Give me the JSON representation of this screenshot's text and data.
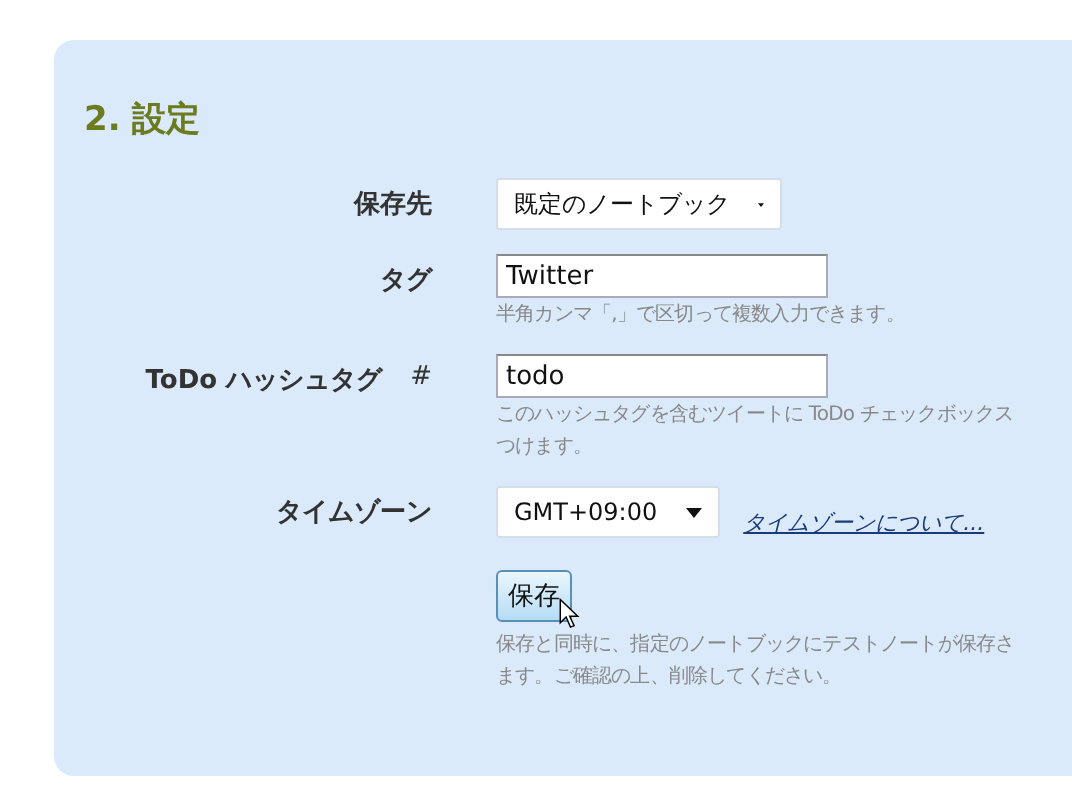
{
  "section": {
    "title": "2. 設定"
  },
  "fields": [
    {
      "kind": "select",
      "label": "保存先",
      "value": "既定のノートブック"
    },
    {
      "kind": "text",
      "label": "タグ",
      "value": "Twitter",
      "hint": [
        "半角カンマ「,」で区切って複数入力できます。"
      ]
    },
    {
      "kind": "text",
      "label": "ToDo ハッシュタグ",
      "prefix": "#",
      "value": "todo",
      "hint": [
        "このハッシュタグを含むツイートに ToDo チェックボックス",
        "つけます。"
      ]
    },
    {
      "kind": "select",
      "label": "タイムゾーン",
      "value": "GMT+09:00",
      "link": "タイムゾーンについて..."
    }
  ],
  "save_button": {
    "label": "保存",
    "hint": [
      "保存と同時に、指定のノートブックにテストノートが保存さ",
      "ます。ご確認の上、削除してください。"
    ]
  }
}
